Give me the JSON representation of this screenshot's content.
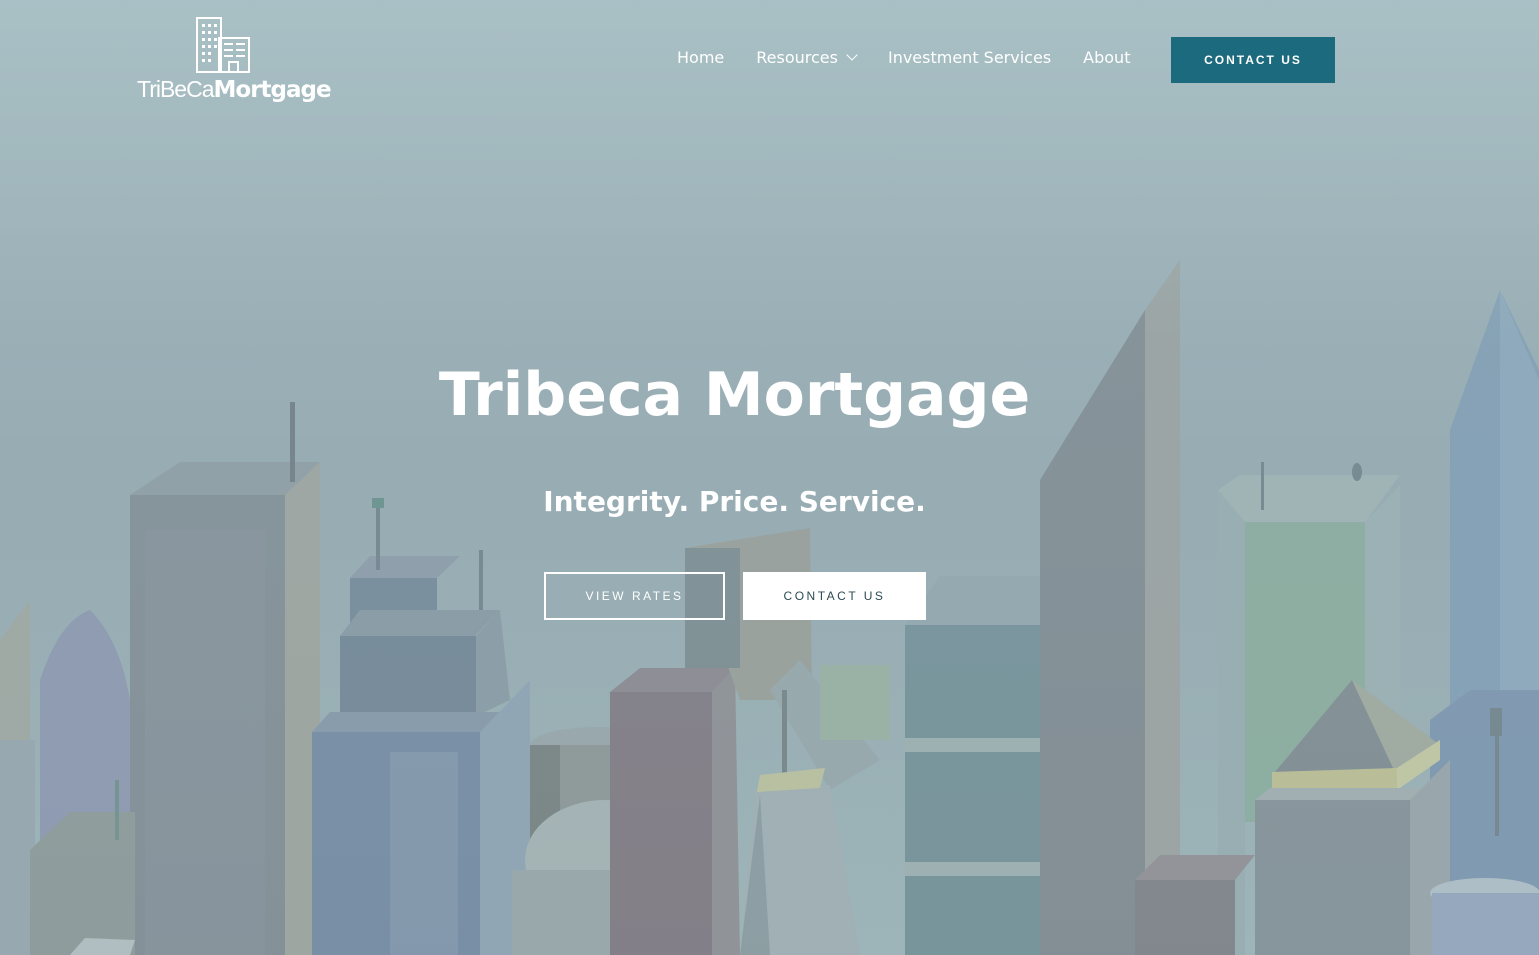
{
  "logo": {
    "text_light": "TriBeCa",
    "text_bold": "Mortgage"
  },
  "nav": {
    "items": [
      {
        "label": "Home"
      },
      {
        "label": "Resources",
        "has_dropdown": true
      },
      {
        "label": "Investment Services"
      },
      {
        "label": "About"
      }
    ],
    "cta_label": "CONTACT US"
  },
  "hero": {
    "title": "Tribeca Mortgage",
    "subtitle": "Integrity. Price. Service.",
    "primary_button": "VIEW RATES",
    "secondary_button": "CONTACT US"
  },
  "colors": {
    "accent": "#1b6a7d",
    "background": "#9fb2b8",
    "text": "#ffffff"
  },
  "icons": {
    "dropdown": "chevron-down-icon",
    "logo_mark": "building-icon"
  }
}
